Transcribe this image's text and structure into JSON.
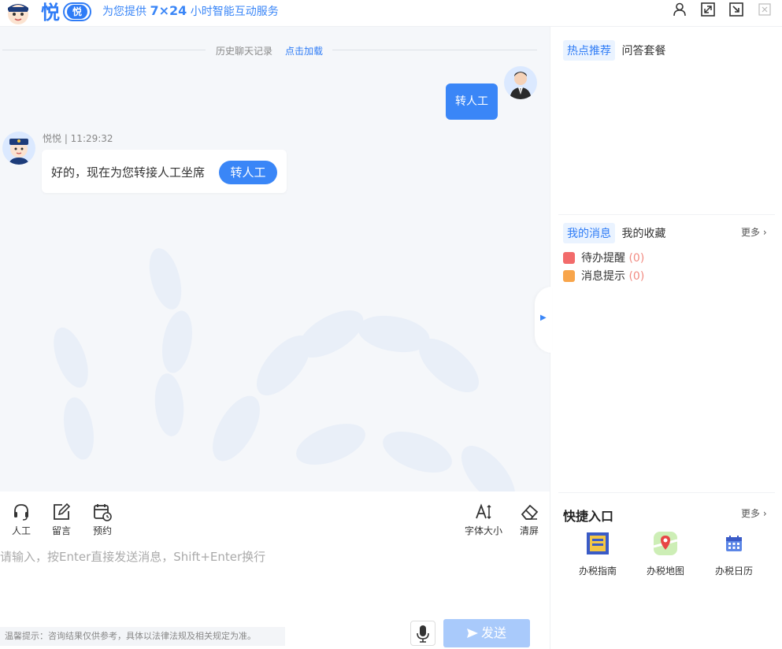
{
  "header": {
    "brand": "悦",
    "badge": "悦",
    "service_prefix": "为您提供 ",
    "service_highlight": "7×24",
    "service_suffix": " 小时智能互动服务"
  },
  "history": {
    "label": "历史聊天记录",
    "load": "点击加载"
  },
  "messages": {
    "user_text": "转人工",
    "bot_meta": "悦悦 | 11:29:32",
    "bot_text": "好的，现在为您转接人工坐席",
    "bot_button": "转人工"
  },
  "toolbar": {
    "human": "人工",
    "note": "留言",
    "book": "预约",
    "font": "字体大小",
    "clear": "清屏"
  },
  "input": {
    "placeholder": "请输入，按Enter直接发送消息，Shift+Enter换行"
  },
  "footer": {
    "tip": "温馨提示：咨询结果仅供参考，具体以法律法规及相关规定为准。",
    "send": "发送"
  },
  "right": {
    "hot_tab": "热点推荐",
    "qa_tab": "问答套餐",
    "msg_tab": "我的消息",
    "fav_tab": "我的收藏",
    "more1": "更多",
    "todo_label": "待办提醒",
    "todo_count": "(0)",
    "notice_label": "消息提示",
    "notice_count": "(0)",
    "quick_title": "快捷入口",
    "more2": "更多",
    "quick": [
      {
        "label": "办税指南",
        "icon": "guide-icon"
      },
      {
        "label": "办税地图",
        "icon": "map-icon"
      },
      {
        "label": "办税日历",
        "icon": "calendar-icon"
      }
    ]
  },
  "colors": {
    "accent": "#3a86f7",
    "send_disabled": "#a9cafb",
    "count": "#f28b82"
  }
}
